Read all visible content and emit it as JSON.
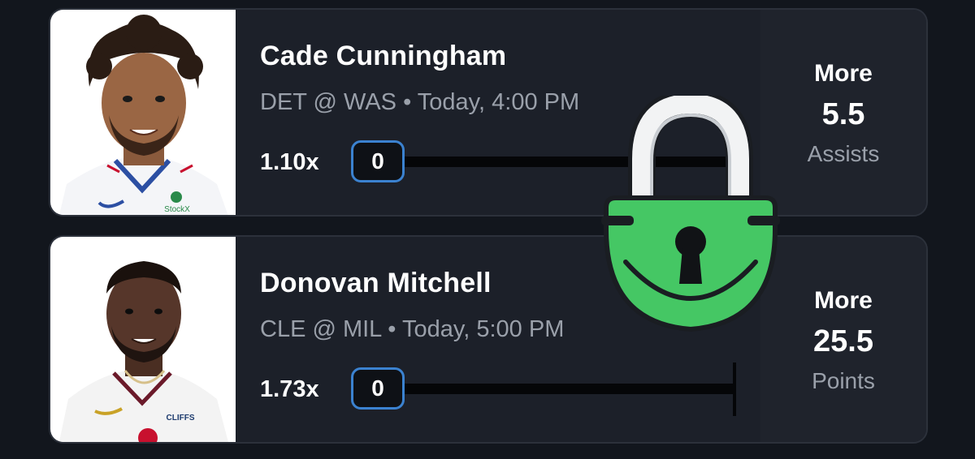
{
  "picks": [
    {
      "player_name": "Cade Cunningham",
      "game": "DET @ WAS",
      "time": "Today, 4:00 PM",
      "multiplier": "1.10x",
      "progress_value": "0",
      "direction": "More",
      "line": "5.5",
      "stat": "Assists"
    },
    {
      "player_name": "Donovan Mitchell",
      "game": "CLE @ MIL",
      "time": "Today, 5:00 PM",
      "multiplier": "1.73x",
      "progress_value": "0",
      "direction": "More",
      "line": "25.5",
      "stat": "Points"
    }
  ],
  "separator": "•",
  "jersey_text": {
    "patch_1": "StockX",
    "patch_2": "CLIFFS"
  },
  "colors": {
    "background": "#12161d",
    "card": "#1c2029",
    "accent_blue": "#3b82d0",
    "lock_green": "#45c764",
    "text_muted": "#9aa0aa"
  },
  "icons": {
    "overlay": "padlock-icon"
  }
}
